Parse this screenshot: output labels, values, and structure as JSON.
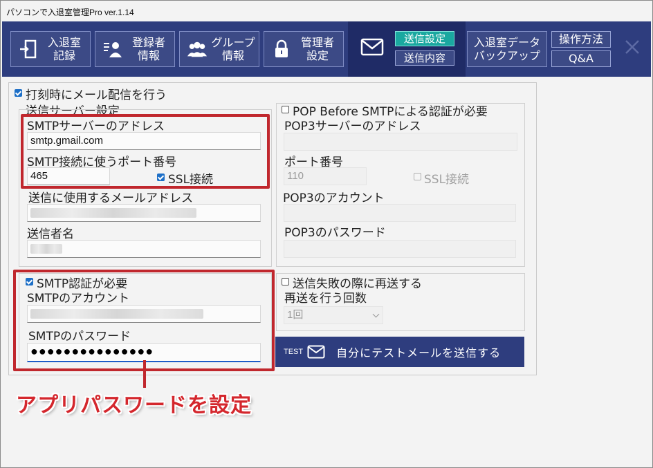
{
  "window": {
    "title": "パソコンで入退室管理Pro ver.1.14"
  },
  "toolbar": {
    "buttons": [
      {
        "label": "入退室\n記録",
        "icon": "door-exit-icon"
      },
      {
        "label": "登録者\n情報",
        "icon": "user-list-icon"
      },
      {
        "label": "グループ\n情報",
        "icon": "group-users-icon"
      },
      {
        "label": "管理者\n設定",
        "icon": "lock-icon"
      }
    ],
    "mail": {
      "icon": "mail-icon",
      "send_settings": "送信設定",
      "send_content": "送信内容"
    },
    "backup": "入退室データ\nバックアップ",
    "manual": "操作方法",
    "faq": "Q&A",
    "close_icon": "close-icon"
  },
  "form": {
    "enable_mail_label": "打刻時にメール配信を行う",
    "enable_mail_checked": true,
    "server_group_label": "送信サーバー設定",
    "smtp_server_label": "SMTPサーバーのアドレス",
    "smtp_server_value": "smtp.gmail.com",
    "smtp_port_label": "SMTP接続に使うポート番号",
    "smtp_port_value": "465",
    "smtp_ssl_label": "SSL接続",
    "smtp_ssl_checked": true,
    "sender_address_label": "送信に使用するメールアドレス",
    "sender_name_label": "送信者名",
    "smtp_auth_label": "SMTP認証が必要",
    "smtp_auth_checked": true,
    "smtp_account_label": "SMTPのアカウント",
    "smtp_password_label": "SMTPのパスワード",
    "smtp_password_value": "●●●●●●●●●●●●●●●"
  },
  "pop": {
    "enable_label": "POP Before SMTPによる認証が必要",
    "enable_checked": false,
    "server_label": "POP3サーバーのアドレス",
    "port_label": "ポート番号",
    "port_value": "110",
    "ssl_label": "SSL接続",
    "account_label": "POP3のアカウント",
    "password_label": "POP3のパスワード"
  },
  "retry": {
    "enable_label": "送信失敗の際に再送する",
    "enable_checked": false,
    "count_label": "再送を行う回数",
    "count_value": "1回"
  },
  "test_button": {
    "prefix": "TEST",
    "icon": "mail-icon",
    "label": "自分にテストメールを送信する"
  },
  "annotation": {
    "text": "アプリパスワードを設定"
  },
  "colors": {
    "toolbar_bg": "#2e3d7e",
    "active_tab": "#1aa8a0",
    "highlight_red": "#c0272d",
    "annotation_text": "#d4272d"
  }
}
